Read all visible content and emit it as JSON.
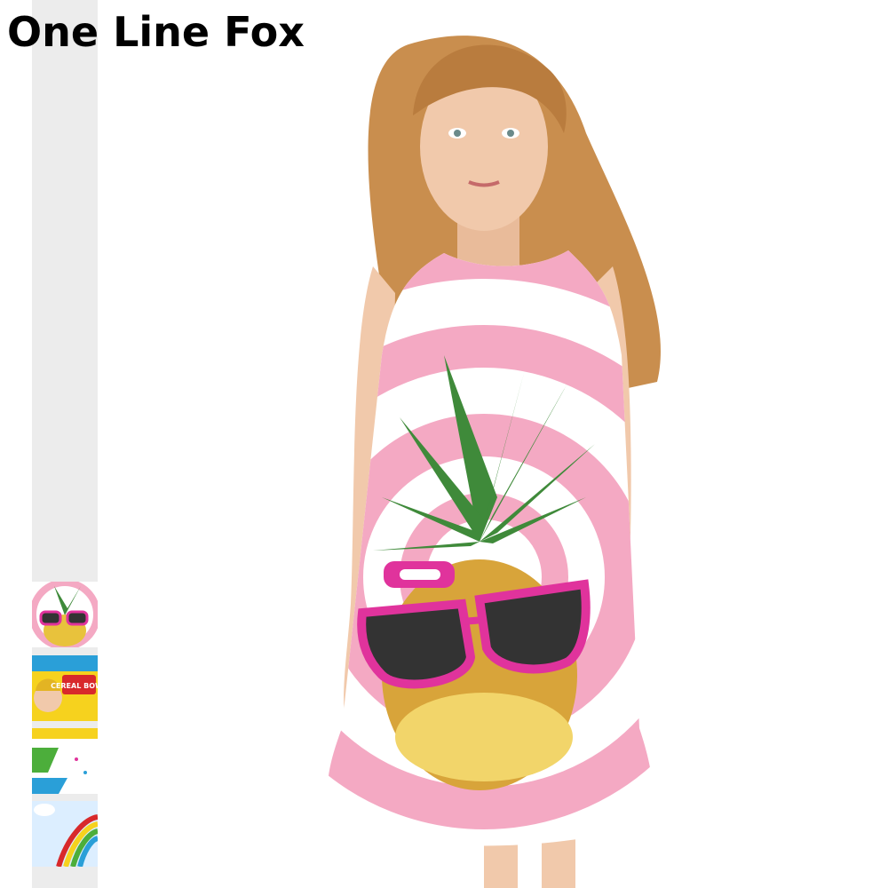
{
  "brand": {
    "name": "One Line Fox"
  },
  "thumbnails": [
    {
      "name": "pineapple-sunglasses-dress"
    },
    {
      "name": "cereal-bowl-comic-dress"
    },
    {
      "name": "green-butterfly-dress"
    },
    {
      "name": "rainbow-raindrop-dress"
    }
  ],
  "thumbnail_text": {
    "cereal": "CEREAL BOWL"
  },
  "colors": {
    "pink": "#f4a9c3",
    "magenta": "#e0339c",
    "leaf_green": "#3f8a3a",
    "pineapple": "#e8c23c",
    "hair": "#c98e4e",
    "skin": "#f1c9ab"
  }
}
